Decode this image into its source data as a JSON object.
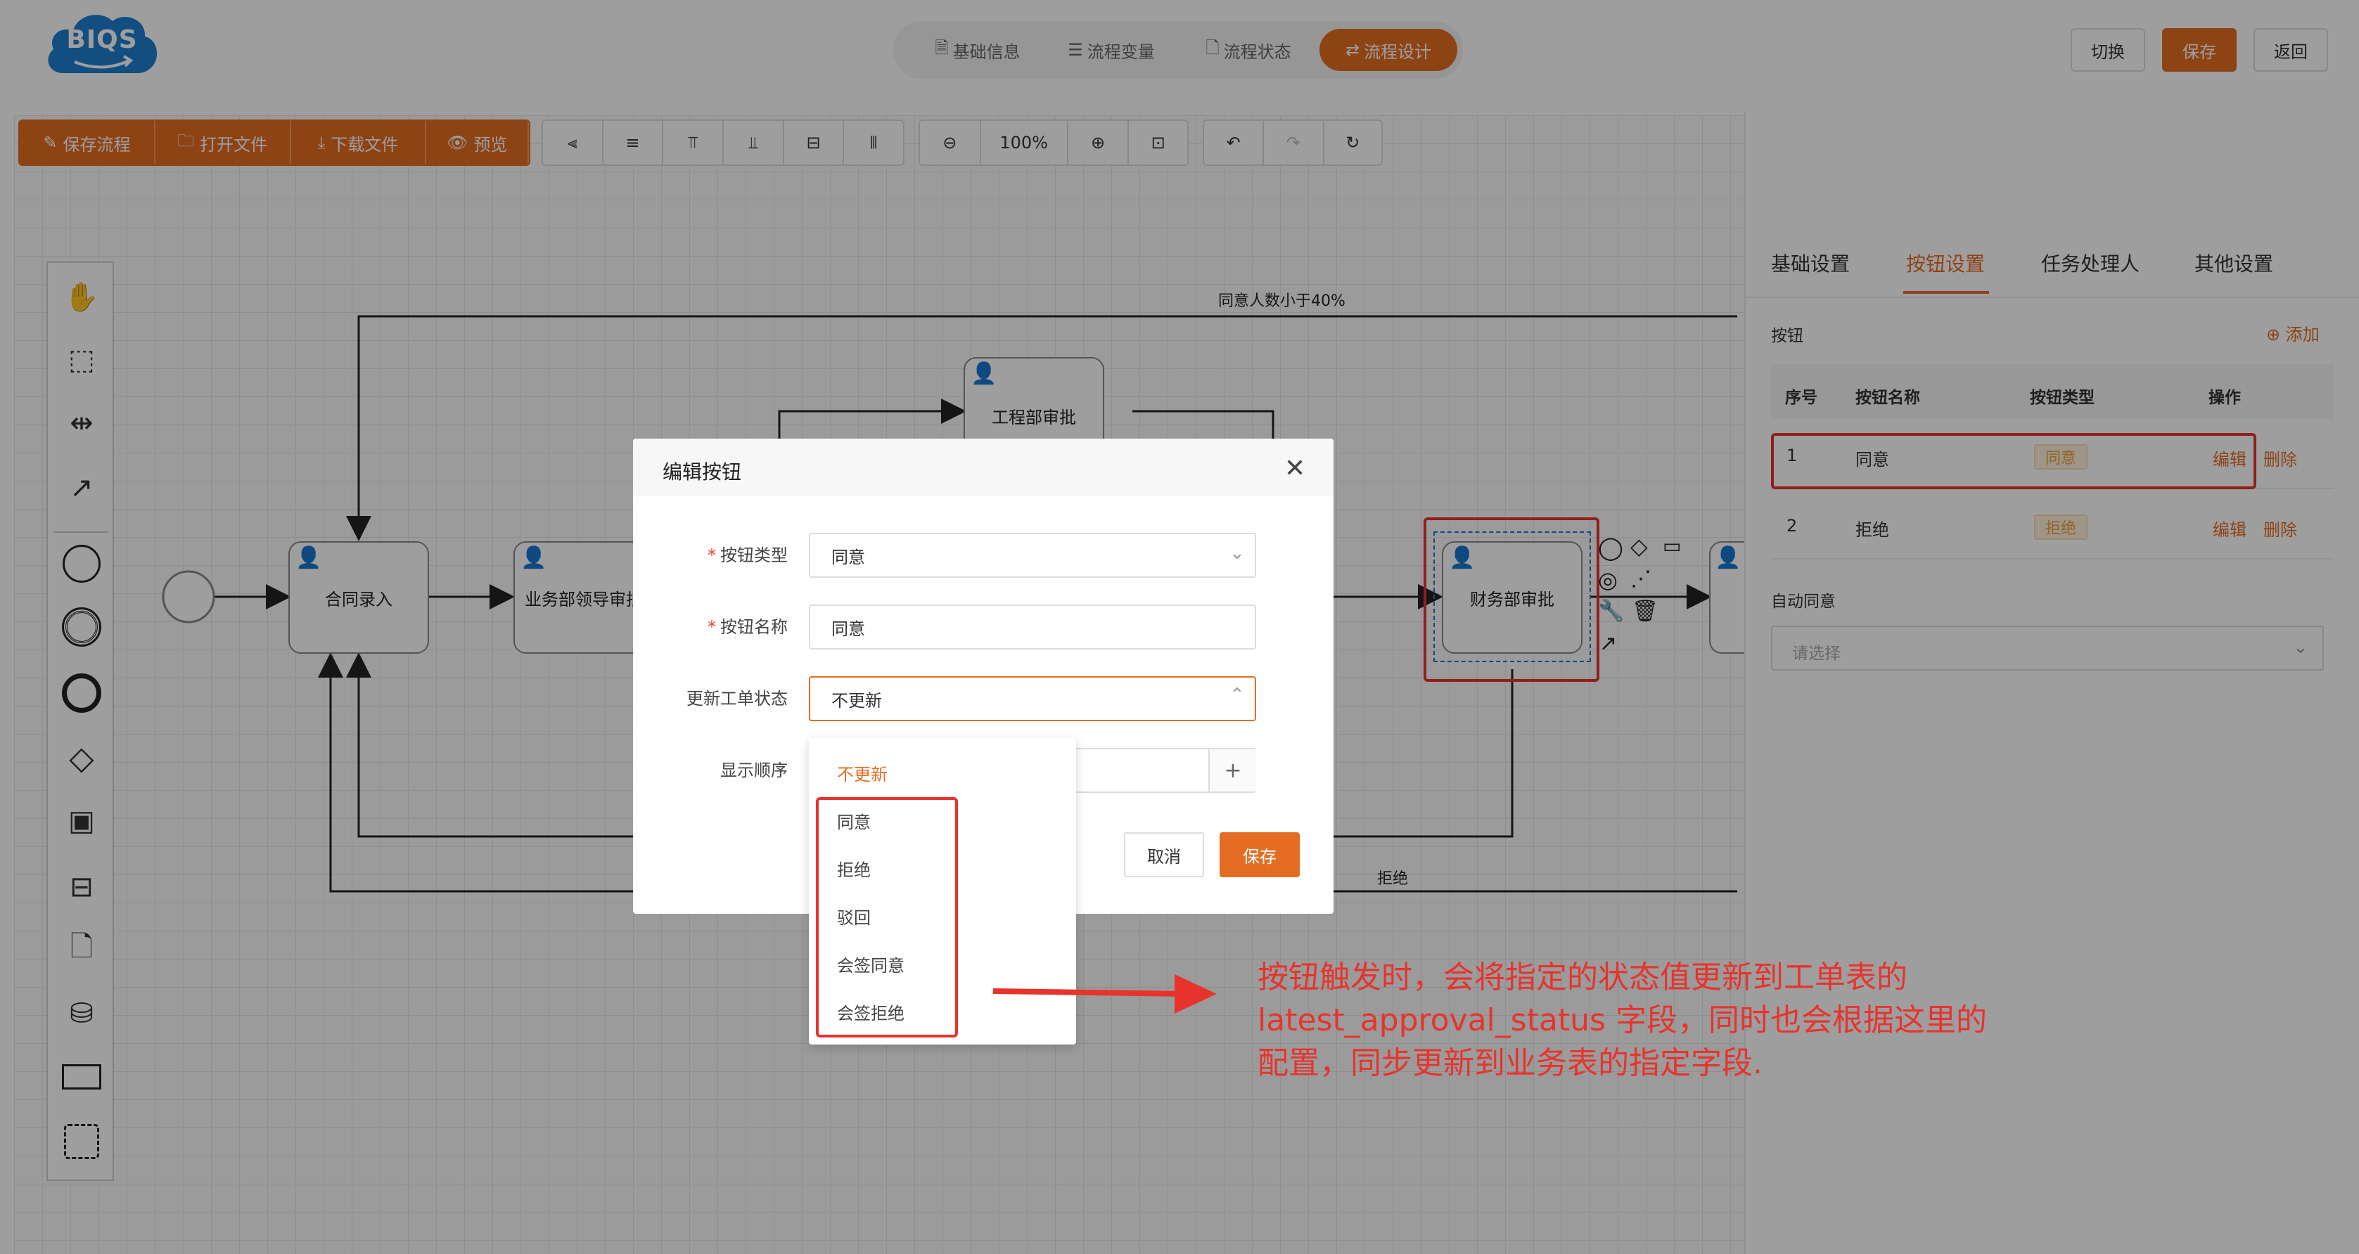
{
  "brand": {
    "logo_text": "BIQS"
  },
  "header": {
    "tabs": [
      {
        "label": "基础信息",
        "icon": "document-icon"
      },
      {
        "label": "流程变量",
        "icon": "sliders-icon"
      },
      {
        "label": "流程状态",
        "icon": "file-icon"
      },
      {
        "label": "流程设计",
        "icon": "flow-icon",
        "active": true
      }
    ],
    "switch_label": "切换",
    "save_label": "保存",
    "back_label": "返回"
  },
  "toolbar": {
    "file_buttons": [
      "保存流程",
      "打开文件",
      "下载文件",
      "预览"
    ],
    "zoom_label": "100%"
  },
  "canvas": {
    "nodes": {
      "contract": "合同录入",
      "biz_leader": "业务部领导审批",
      "engineering": "工程部审批",
      "finance": "财务部审批"
    },
    "edge_labels": {
      "top": "同意人数小于40%",
      "bottom": "拒绝"
    }
  },
  "right_panel": {
    "tabs": [
      "基础设置",
      "按钮设置",
      "任务处理人",
      "其他设置"
    ],
    "active_tab": "按钮设置",
    "section_title": "按钮",
    "add_label": "添加",
    "table": {
      "headers": [
        "序号",
        "按钮名称",
        "按钮类型",
        "操作"
      ],
      "rows": [
        {
          "index": "1",
          "name": "同意",
          "type": "同意",
          "edit": "编辑",
          "delete": "删除"
        },
        {
          "index": "2",
          "name": "拒绝",
          "type": "拒绝",
          "edit": "编辑",
          "delete": "删除"
        }
      ]
    },
    "auto_agree_label": "自动同意",
    "auto_agree_placeholder": "请选择"
  },
  "modal": {
    "title": "编辑按钮",
    "fields": {
      "type_label": "按钮类型",
      "type_value": "同意",
      "name_label": "按钮名称",
      "name_value": "同意",
      "status_label": "更新工单状态",
      "status_value": "不更新",
      "order_label": "显示顺序"
    },
    "cancel_label": "取消",
    "save_label": "保存",
    "dropdown_options": [
      "不更新",
      "同意",
      "拒绝",
      "驳回",
      "会签同意",
      "会签拒绝"
    ],
    "selected_option": "不更新"
  },
  "annotation": {
    "lines": [
      "按钮触发时，会将指定的状态值更新到工单表的",
      "latest_approval_status 字段，同时也会根据这里的",
      "配置，同步更新到业务表的指定字段."
    ],
    "color": "#e8332d"
  },
  "colors": {
    "accent": "#e56d23",
    "highlight": "#e8332d"
  }
}
